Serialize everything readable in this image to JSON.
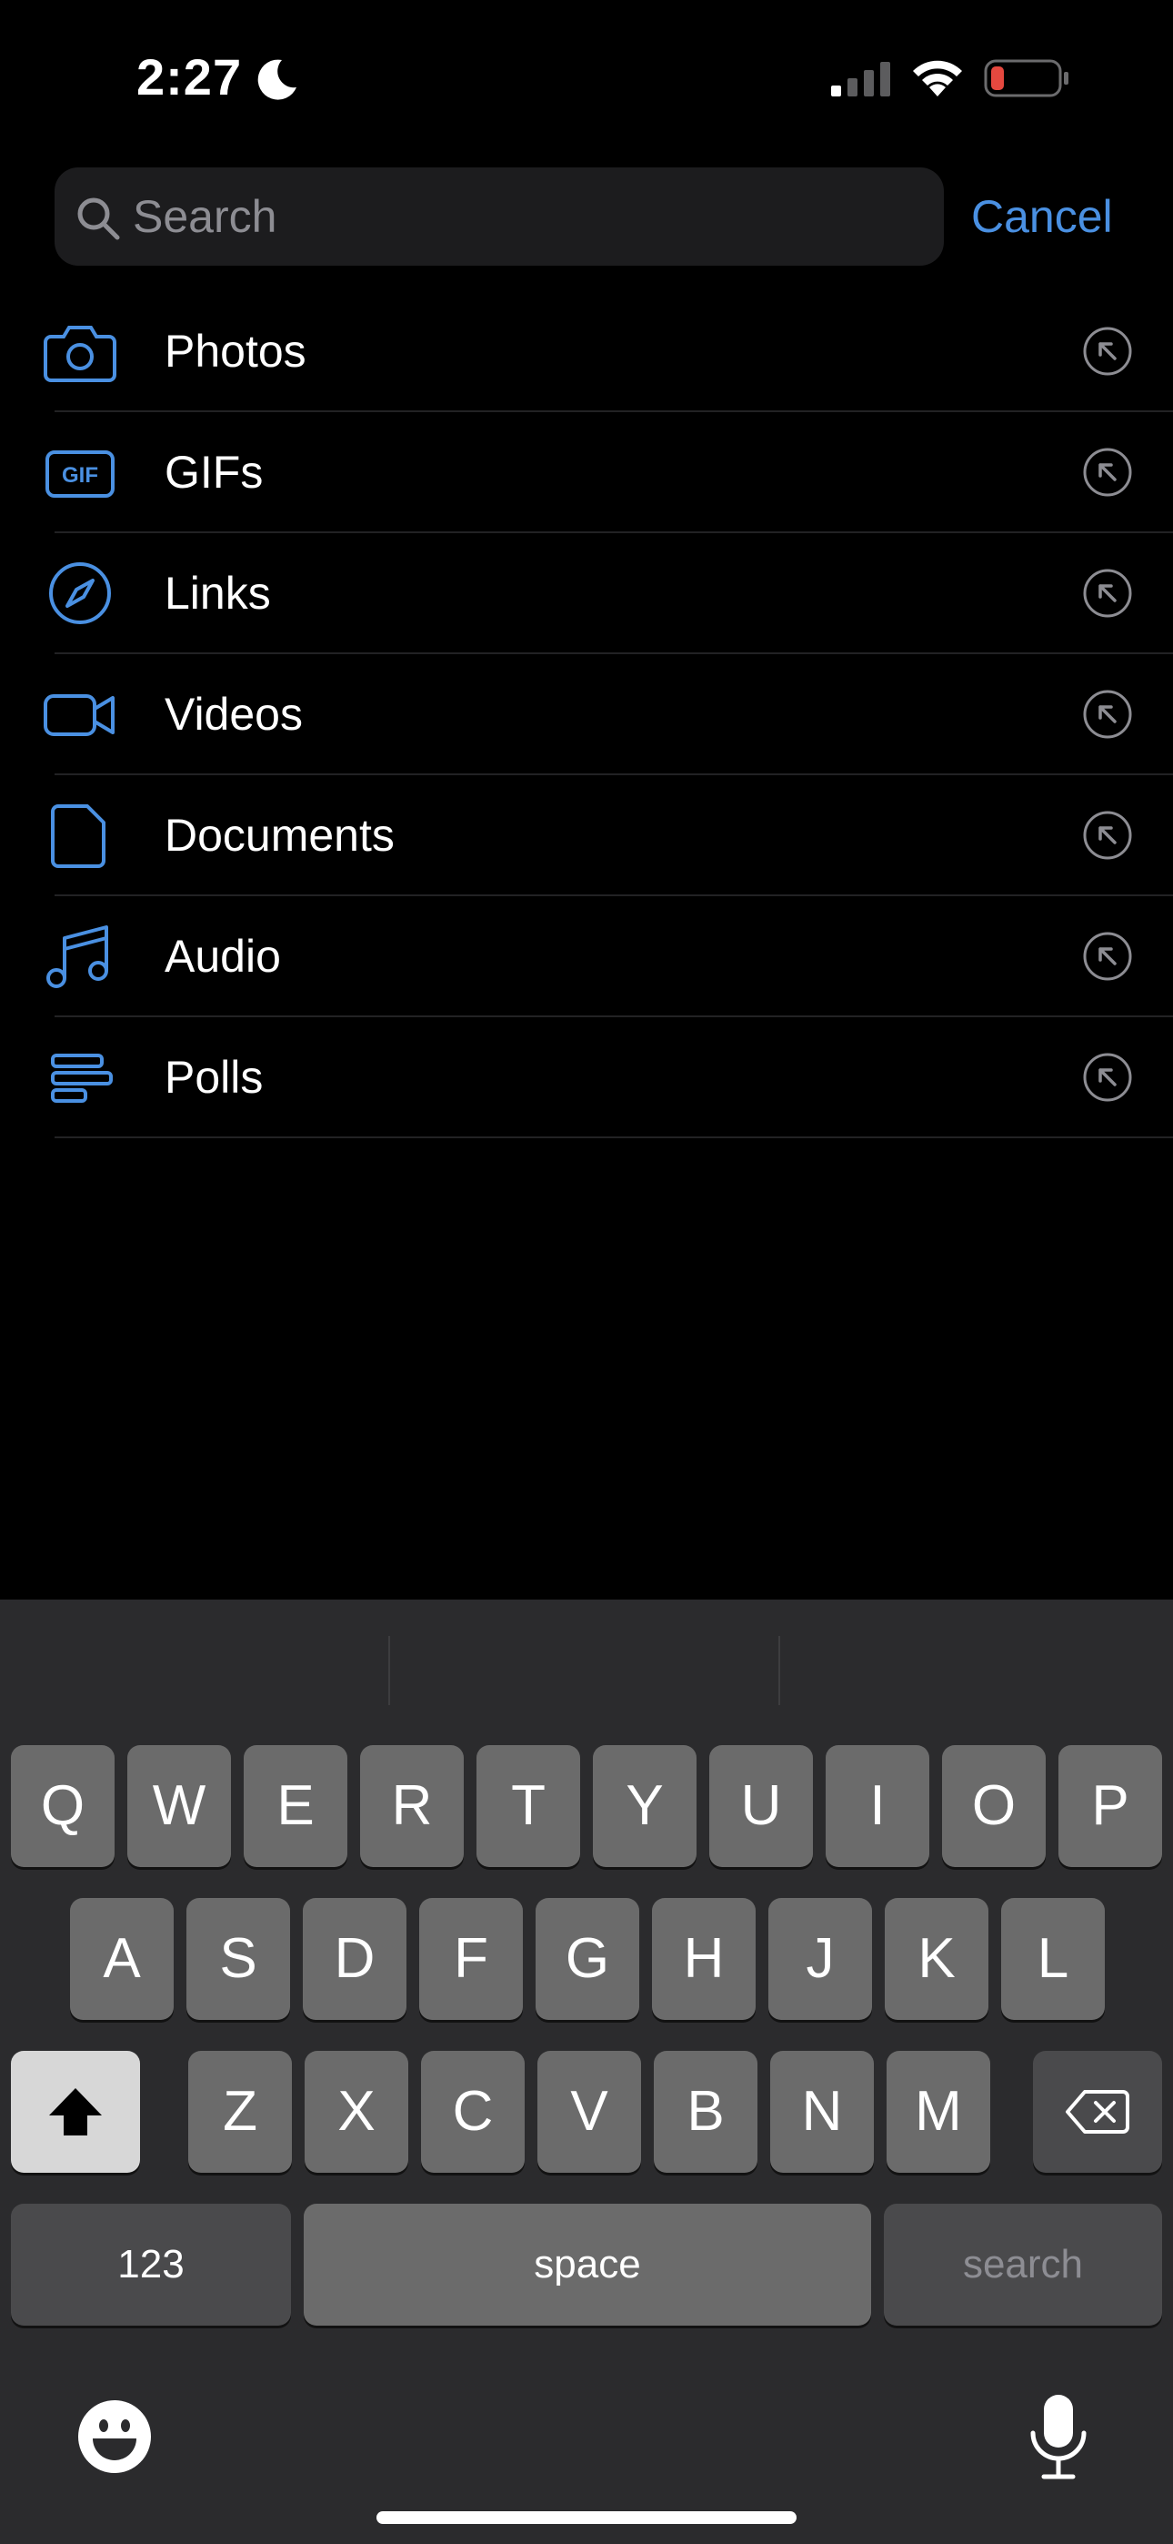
{
  "status_bar": {
    "time": "2:27",
    "focus_icon": "moon-icon",
    "signal_icon": "cellular-signal-icon",
    "wifi_icon": "wifi-icon",
    "battery_icon": "battery-low-icon"
  },
  "search": {
    "placeholder": "Search",
    "value": "",
    "cancel_label": "Cancel"
  },
  "filters": [
    {
      "label": "Photos",
      "icon": "camera-icon"
    },
    {
      "label": "GIFs",
      "icon": "gif-icon"
    },
    {
      "label": "Links",
      "icon": "compass-icon"
    },
    {
      "label": "Videos",
      "icon": "video-camera-icon"
    },
    {
      "label": "Documents",
      "icon": "document-icon"
    },
    {
      "label": "Audio",
      "icon": "music-note-icon"
    },
    {
      "label": "Polls",
      "icon": "poll-icon"
    }
  ],
  "keyboard": {
    "row1": [
      "Q",
      "W",
      "E",
      "R",
      "T",
      "Y",
      "U",
      "I",
      "O",
      "P"
    ],
    "row2": [
      "A",
      "S",
      "D",
      "F",
      "G",
      "H",
      "J",
      "K",
      "L"
    ],
    "row3": [
      "Z",
      "X",
      "C",
      "V",
      "B",
      "N",
      "M"
    ],
    "numbers_label": "123",
    "space_label": "space",
    "return_label": "search"
  },
  "colors": {
    "accent": "#4a90e2",
    "background": "#000000",
    "keyboard_background": "#2b2b2d",
    "key": "#6b6b6b",
    "battery_low": "#e5483f"
  }
}
